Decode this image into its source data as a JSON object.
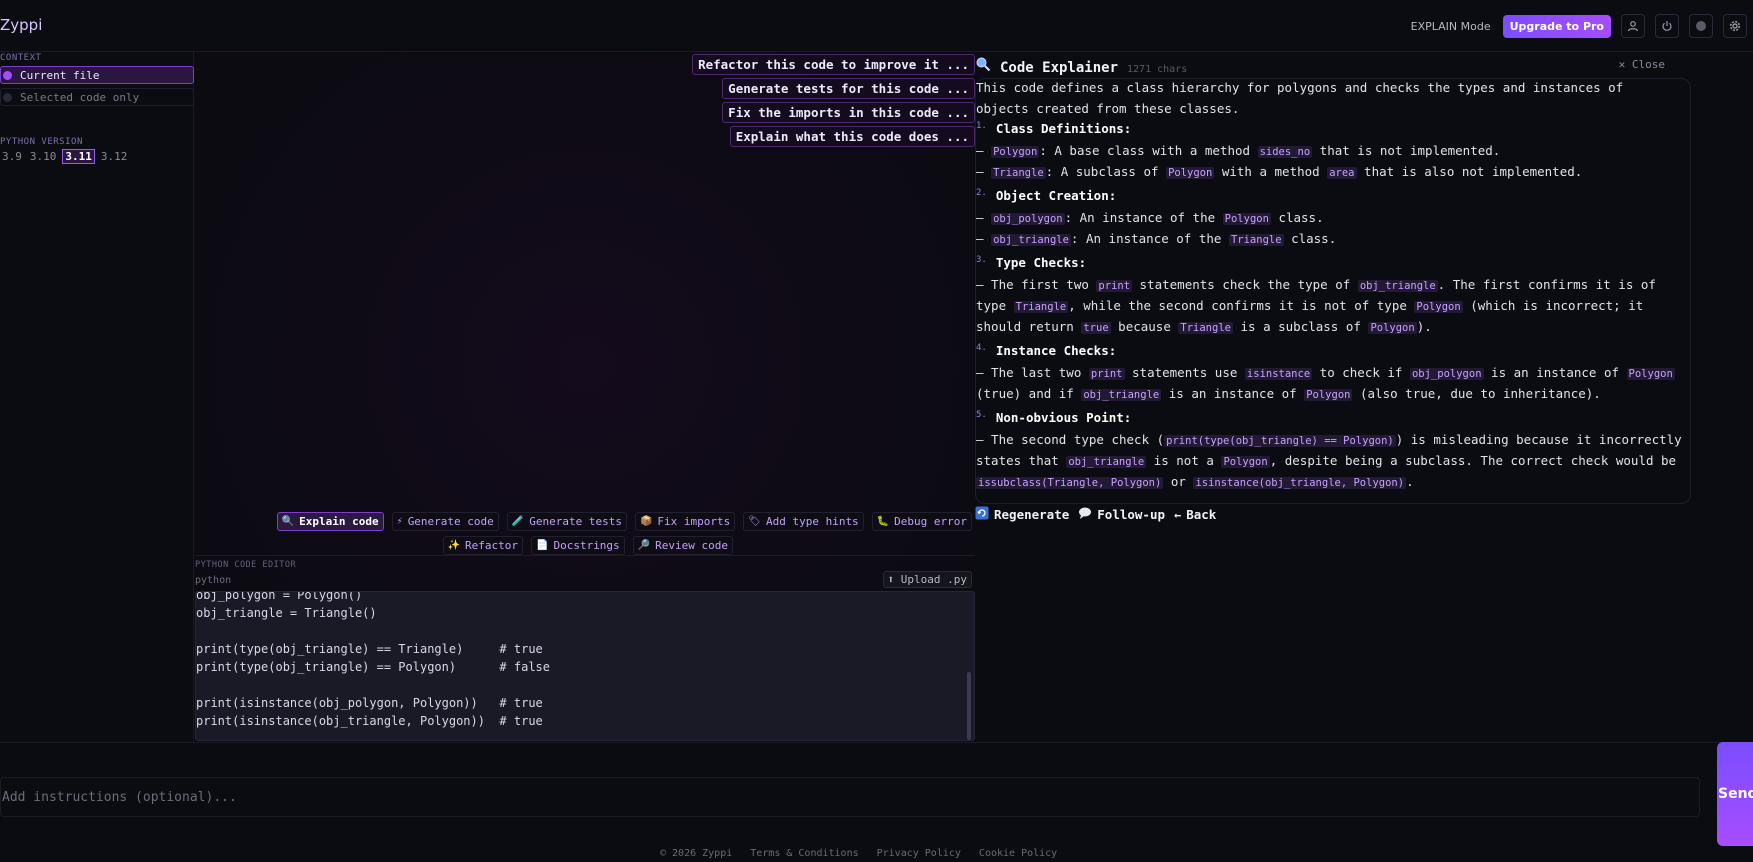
{
  "header": {
    "brand": "Zyppi",
    "mode_label": "EXPLAIN Mode",
    "upgrade_label": "Upgrade to Pro",
    "icons": [
      "user-icon",
      "power-icon",
      "help-icon",
      "gear-icon"
    ]
  },
  "sidebar": {
    "context_heading": "CONTEXT",
    "context_options": [
      {
        "label": "Current file",
        "selected": true
      },
      {
        "label": "Selected code only",
        "selected": false
      }
    ],
    "python_heading": "PYTHON VERSION",
    "python_versions": [
      "3.9",
      "3.10",
      "3.11",
      "3.12"
    ],
    "python_selected": "3.11"
  },
  "suggestions": [
    "Refactor this code to improve it ...",
    "Generate tests for this code ...",
    "Fix the imports in this code ...",
    "Explain what this code does ..."
  ],
  "actions": {
    "row1": [
      {
        "label": "Explain code",
        "icon": "🔍",
        "active": true
      },
      {
        "label": "Generate code",
        "icon": "⚡",
        "active": false
      },
      {
        "label": "Generate tests",
        "icon": "🧪",
        "active": false
      },
      {
        "label": "Fix imports",
        "icon": "📦",
        "active": false
      },
      {
        "label": "Add type hints",
        "icon": "🏷",
        "active": false
      },
      {
        "label": "Debug error",
        "icon": "🐛",
        "active": false
      }
    ],
    "row2": [
      {
        "label": "Refactor",
        "icon": "✨",
        "active": false
      },
      {
        "label": "Docstrings",
        "icon": "📄",
        "active": false
      },
      {
        "label": "Review code",
        "icon": "🔎",
        "active": false
      }
    ]
  },
  "editor": {
    "title": "PYTHON CODE EDITOR",
    "language": "python",
    "upload_label": "⬆ Upload .py",
    "lines": [
      "obj_polygon = Polygon()",
      "obj_triangle = Triangle()",
      "",
      "print(type(obj_triangle) == Triangle)     # true",
      "print(type(obj_triangle) == Polygon)      # false",
      "",
      "print(isinstance(obj_polygon, Polygon))   # true",
      "print(isinstance(obj_triangle, Polygon))  # true"
    ]
  },
  "explainer": {
    "title": "Code Explainer",
    "char_count": "1271 chars",
    "close_label": "✕ Close",
    "intro_1": "This code defines a class hierarchy for polygons and checks the types and instances of",
    "intro_2": "objects created from these classes.",
    "s1_num": "1.",
    "s1_title": "Class Definitions",
    "s1_b1_code": "Polygon",
    "s1_b1_a": ": A base class with a method ",
    "s1_b1_code2": "sides_no",
    "s1_b1_b": " that is not implemented.",
    "s1_b2_code": "Triangle",
    "s1_b2_a": ": A subclass of ",
    "s1_b2_code2": "Polygon",
    "s1_b2_b": " with a method ",
    "s1_b2_code3": "area",
    "s1_b2_c": " that is also not implemented.",
    "s2_num": "2.",
    "s2_title": "Object Creation",
    "s2_b1_code": "obj_polygon",
    "s2_b1_a": ": An instance of the ",
    "s2_b1_code2": "Polygon",
    "s2_b1_b": " class.",
    "s2_b2_code": "obj_triangle",
    "s2_b2_a": ": An instance of the ",
    "s2_b2_code2": "Triangle",
    "s2_b2_b": " class.",
    "s3_num": "3.",
    "s3_title": "Type Checks",
    "s3_l1_a": "– The first two ",
    "s3_l1_code": "print",
    "s3_l1_b": " statements check the type of ",
    "s3_l1_code2": "obj_triangle",
    "s3_l1_c": ". The first confirms it is of",
    "s3_l2_a": "type ",
    "s3_l2_code": "Triangle",
    "s3_l2_b": ", while the second confirms it is not of type ",
    "s3_l2_code2": "Polygon",
    "s3_l2_c": " (which is incorrect; it",
    "s3_l3_a": "should return ",
    "s3_l3_code": "true",
    "s3_l3_b": " because ",
    "s3_l3_code2": "Triangle",
    "s3_l3_c": " is a subclass of ",
    "s3_l3_code3": "Polygon",
    "s3_l3_d": ").",
    "s4_num": "4.",
    "s4_title": "Instance Checks",
    "s4_l1_a": "– The last two ",
    "s4_l1_code": "print",
    "s4_l1_b": " statements use ",
    "s4_l1_code2": "isinstance",
    "s4_l1_c": " to check if ",
    "s4_l1_code3": "obj_polygon",
    "s4_l1_d": " is an instance of ",
    "s4_l1_code4": "Polygon",
    "s4_l2_a": "(true) and if ",
    "s4_l2_code": "obj_triangle",
    "s4_l2_b": " is an instance of ",
    "s4_l2_code2": "Polygon",
    "s4_l2_c": " (also true, due to inheritance).",
    "s5_num": "5.",
    "s5_title": "Non-obvious Point",
    "s5_l1_a": "– The second type check (",
    "s5_l1_code": "print(type(obj_triangle) == Polygon)",
    "s5_l1_b": ") is misleading because it incorrectly",
    "s5_l2_a": "states that ",
    "s5_l2_code": "obj_triangle",
    "s5_l2_b": " is not a ",
    "s5_l2_code2": "Polygon",
    "s5_l2_c": ", despite being a subclass. The correct check would be",
    "s5_l3_code": "issubclass(Triangle, Polygon)",
    "s5_l3_a": " or ",
    "s5_l3_code2": "isinstance(obj_triangle, Polygon)",
    "s5_l3_b": ".",
    "regenerate_label": "Regenerate",
    "followup_label": "Follow-up",
    "back_label": "Back"
  },
  "instructions": {
    "placeholder": "Add instructions (optional)...",
    "send_label": "Send"
  },
  "footer": {
    "copyright": "© 2026 Zyppi",
    "terms": "Terms & Conditions",
    "privacy": "Privacy Policy",
    "cookie": "Cookie Policy"
  }
}
